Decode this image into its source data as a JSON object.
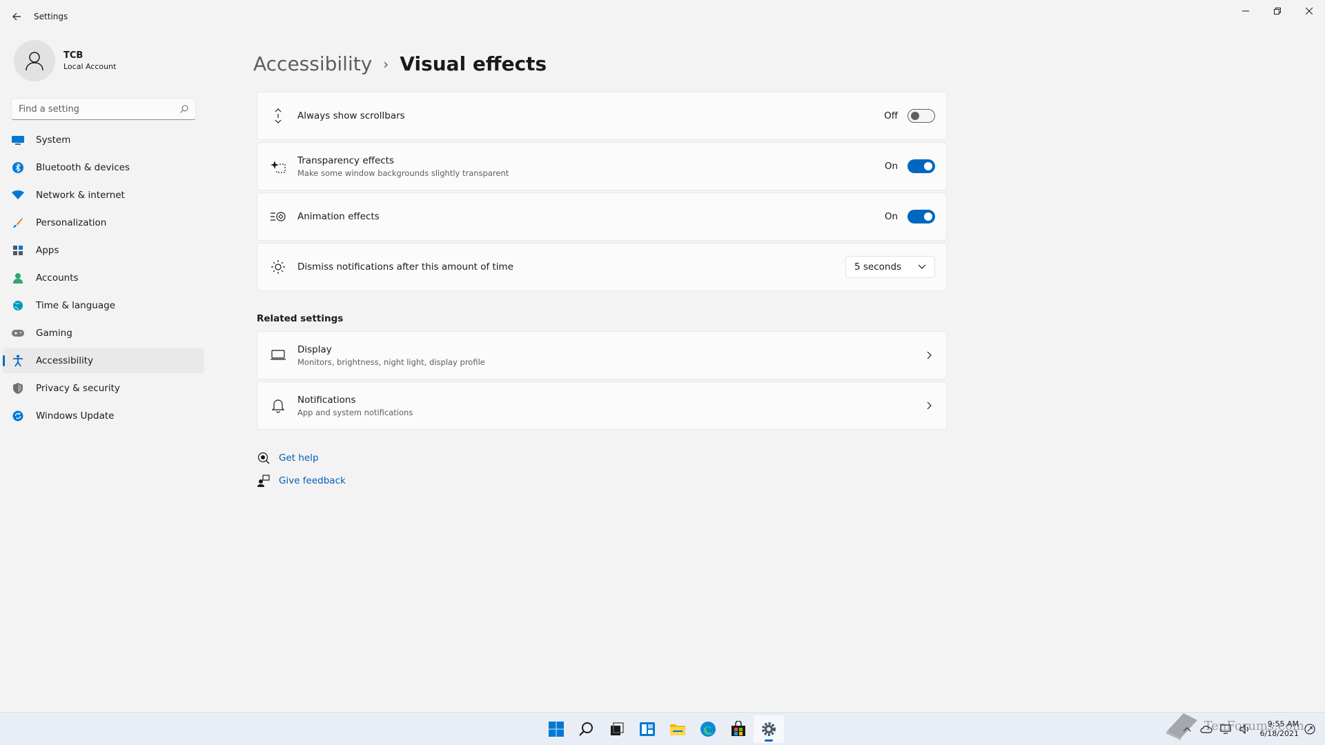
{
  "window": {
    "title": "Settings"
  },
  "user": {
    "name": "TCB",
    "account_type": "Local Account"
  },
  "search": {
    "placeholder": "Find a setting"
  },
  "nav": {
    "items": [
      {
        "label": "System",
        "icon": "system-icon",
        "color": "#0078d4"
      },
      {
        "label": "Bluetooth & devices",
        "icon": "bluetooth-icon",
        "color": "#0078d4"
      },
      {
        "label": "Network & internet",
        "icon": "network-icon",
        "color": "#0078d4"
      },
      {
        "label": "Personalization",
        "icon": "brush-icon",
        "color": "#e8710a"
      },
      {
        "label": "Apps",
        "icon": "apps-icon",
        "color": "#4a5a6a"
      },
      {
        "label": "Accounts",
        "icon": "accounts-icon",
        "color": "#2fa66b"
      },
      {
        "label": "Time & language",
        "icon": "globe-icon",
        "color": "#0099bc"
      },
      {
        "label": "Gaming",
        "icon": "gamepad-icon",
        "color": "#6e6e6e"
      },
      {
        "label": "Accessibility",
        "icon": "accessibility-icon",
        "color": "#0067c0"
      },
      {
        "label": "Privacy & security",
        "icon": "shield-icon",
        "color": "#6e6e6e"
      },
      {
        "label": "Windows Update",
        "icon": "update-icon",
        "color": "#0078d4"
      }
    ],
    "active_index": 8
  },
  "breadcrumb": {
    "parent": "Accessibility",
    "separator": "›",
    "current": "Visual effects"
  },
  "settings": {
    "scrollbars": {
      "title": "Always show scrollbars",
      "state_label": "Off",
      "on": false
    },
    "transparency": {
      "title": "Transparency effects",
      "subtitle": "Make some window backgrounds slightly transparent",
      "state_label": "On",
      "on": true
    },
    "animation": {
      "title": "Animation effects",
      "state_label": "On",
      "on": true
    },
    "dismiss": {
      "title": "Dismiss notifications after this amount of time",
      "value": "5 seconds"
    }
  },
  "related": {
    "title": "Related settings",
    "display": {
      "title": "Display",
      "subtitle": "Monitors, brightness, night light, display profile"
    },
    "notifications": {
      "title": "Notifications",
      "subtitle": "App and system notifications"
    }
  },
  "links": {
    "help": "Get help",
    "feedback": "Give feedback"
  },
  "taskbar": {
    "apps": [
      "start-icon",
      "search-icon",
      "task-view-icon",
      "widgets-icon",
      "file-explorer-icon",
      "edge-icon",
      "store-icon",
      "settings-icon"
    ],
    "clock_time": "9:55 AM",
    "clock_date": "6/18/2021"
  },
  "watermark": {
    "text": "TenForums.com"
  },
  "colors": {
    "accent": "#0067c0",
    "background": "#f3f3f3",
    "card": "#fbfbfb"
  }
}
